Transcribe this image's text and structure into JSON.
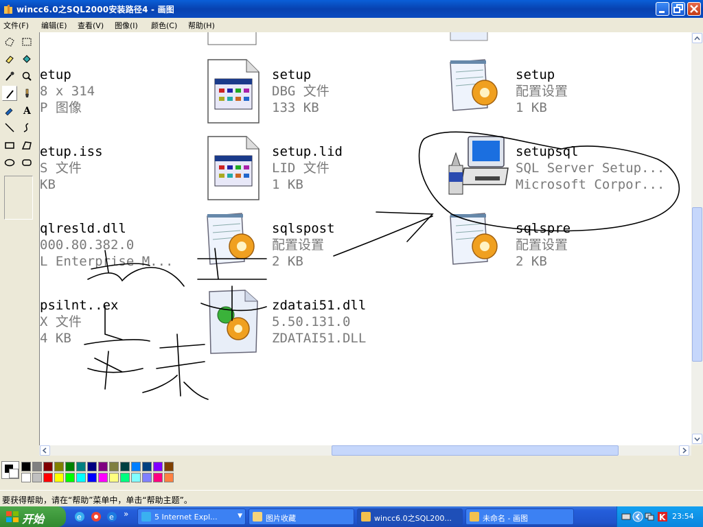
{
  "window": {
    "title": "wincc6.0之SQL2000安装路径4 - 画图"
  },
  "menu": [
    "文件(F)",
    "编辑(E)",
    "查看(V)",
    "图像(I)",
    "颜色(C)",
    "帮助(H)"
  ],
  "tools": [
    "free-select",
    "rect-select",
    "eraser",
    "fill",
    "color-picker",
    "magnifier",
    "pencil",
    "brush",
    "airbrush",
    "text",
    "line",
    "curve",
    "rectangle",
    "polygon",
    "ellipse",
    "rounded-rectangle"
  ],
  "files": [
    {
      "name": "setup",
      "line2": "DBG 文件",
      "line3": "133 KB",
      "icon": "dbg-file-icon"
    },
    {
      "name": "setup",
      "line2": "配置设置",
      "line3": "1 KB",
      "icon": "config-file-icon"
    },
    {
      "name": "etup.iss",
      "line2": "S 文件",
      "line3": "KB",
      "icon": ""
    },
    {
      "name": "setup.lid",
      "line2": "LID 文件",
      "line3": "1 KB",
      "icon": "lid-file-icon"
    },
    {
      "name": "setupsql",
      "line2": "SQL Server Setup...",
      "line3": "Microsoft Corpor...",
      "icon": "sql-setup-icon"
    },
    {
      "name": "qlresld.dll",
      "line2": "000.80.382.0",
      "line3": "L Enterprise M...",
      "icon": ""
    },
    {
      "name": "sqlspost",
      "line2": "配置设置",
      "line3": "2 KB",
      "icon": "config-file-icon"
    },
    {
      "name": "sqlspre",
      "line2": "配置设置",
      "line3": "2 KB",
      "icon": "config-file-icon"
    },
    {
      "name": "psilnt..ex",
      "line2": "X 文件",
      "line3": "4 KB",
      "icon": ""
    },
    {
      "name": "zdatai51.dll",
      "line2": "5.50.131.0",
      "line3": "ZDATAI51.DLL",
      "icon": "dll-file-icon"
    },
    {
      "name": "etup",
      "line2": "8 x 314",
      "line3": "P 图像",
      "icon": ""
    }
  ],
  "palette": {
    "row1": [
      "#000000",
      "#808080",
      "#800000",
      "#808000",
      "#008000",
      "#008080",
      "#000080",
      "#800080",
      "#808040",
      "#004040",
      "#0080ff",
      "#004080",
      "#8000ff",
      "#804000"
    ],
    "row2": [
      "#ffffff",
      "#c0c0c0",
      "#ff0000",
      "#ffff00",
      "#00ff00",
      "#00ffff",
      "#0000ff",
      "#ff00ff",
      "#ffff80",
      "#00ff80",
      "#80ffff",
      "#8080ff",
      "#ff0080",
      "#ff8040"
    ]
  },
  "status": "要获得帮助，请在“帮助”菜单中，单击“帮助主题”。",
  "taskbar": {
    "start": "开始",
    "tasks": [
      "5 Internet Expl...",
      "图片收藏",
      "wincc6.0之SQL200...",
      "未命名 - 画图"
    ],
    "clock": "23:54"
  }
}
